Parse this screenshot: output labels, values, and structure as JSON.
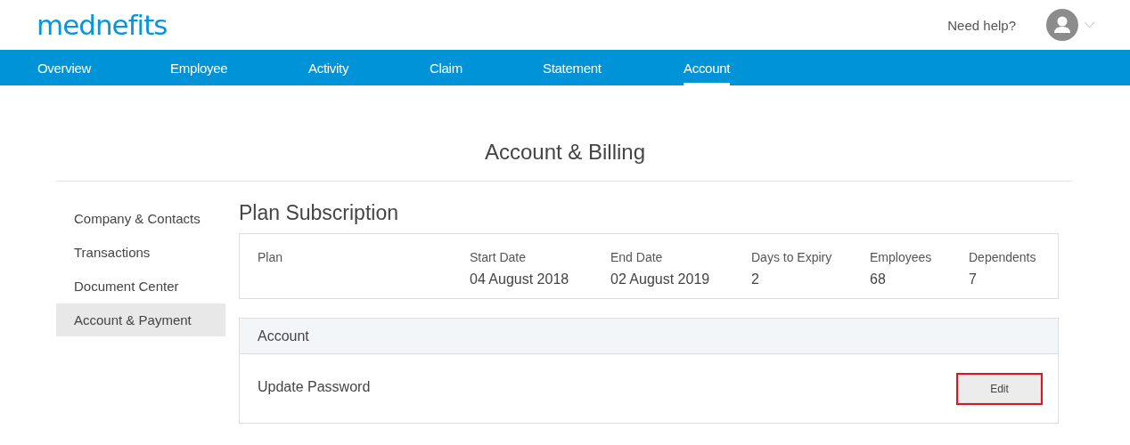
{
  "header": {
    "logo": "mednefits",
    "help_link": "Need help?"
  },
  "nav": [
    {
      "label": "Overview",
      "selected": false
    },
    {
      "label": "Employee",
      "selected": false
    },
    {
      "label": "Activity",
      "selected": false
    },
    {
      "label": "Claim",
      "selected": false
    },
    {
      "label": "Statement",
      "selected": false
    },
    {
      "label": "Account",
      "selected": true
    }
  ],
  "page_title": "Account & Billing",
  "sidebar": [
    {
      "label": "Company & Contacts",
      "selected": false
    },
    {
      "label": "Transactions",
      "selected": false
    },
    {
      "label": "Document Center",
      "selected": false
    },
    {
      "label": "Account & Payment",
      "selected": true
    }
  ],
  "plan": {
    "title": "Plan Subscription",
    "columns": [
      {
        "label": "Plan"
      },
      {
        "label": "Start Date",
        "value": "04 August 2018"
      },
      {
        "label": "End Date",
        "value": "02 August 2019"
      },
      {
        "label": "Days to Expiry",
        "value": "2"
      },
      {
        "label": "Employees",
        "value": "68"
      },
      {
        "label": "Dependents",
        "value": "7"
      }
    ]
  },
  "account": {
    "title": "Account",
    "rows": [
      {
        "label": "Update Password",
        "button": "Edit",
        "highlighted": true
      }
    ]
  }
}
